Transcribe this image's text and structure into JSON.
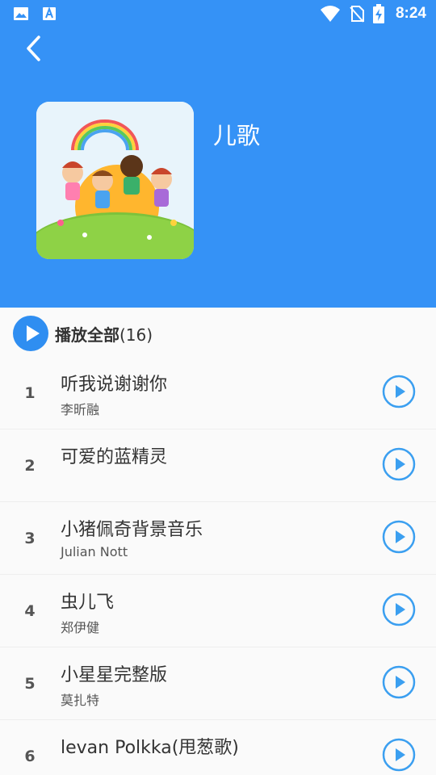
{
  "status_bar": {
    "time": "8:24"
  },
  "header": {
    "title": "儿歌"
  },
  "play_all": {
    "label": "播放全部",
    "count": "(16)"
  },
  "songs": [
    {
      "number": "1",
      "title": "听我说谢谢你",
      "artist": "李昕融"
    },
    {
      "number": "2",
      "title": "可爱的蓝精灵",
      "artist": ""
    },
    {
      "number": "3",
      "title": "小猪佩奇背景音乐",
      "artist": "Julian Nott"
    },
    {
      "number": "4",
      "title": "虫儿飞",
      "artist": "郑伊健"
    },
    {
      "number": "5",
      "title": "小星星完整版",
      "artist": "莫扎特"
    },
    {
      "number": "6",
      "title": "levan Polkka(甩葱歌)",
      "artist": ""
    }
  ],
  "colors": {
    "header": "#3592f6",
    "accent": "#2f8ef1",
    "play_icon": "#3b9ff0"
  },
  "icons": [
    "image-icon",
    "text-a-icon",
    "wifi-icon",
    "no-sim-icon",
    "battery-charging-icon",
    "back-arrow-icon",
    "play-all-icon",
    "play-circle-icon"
  ]
}
